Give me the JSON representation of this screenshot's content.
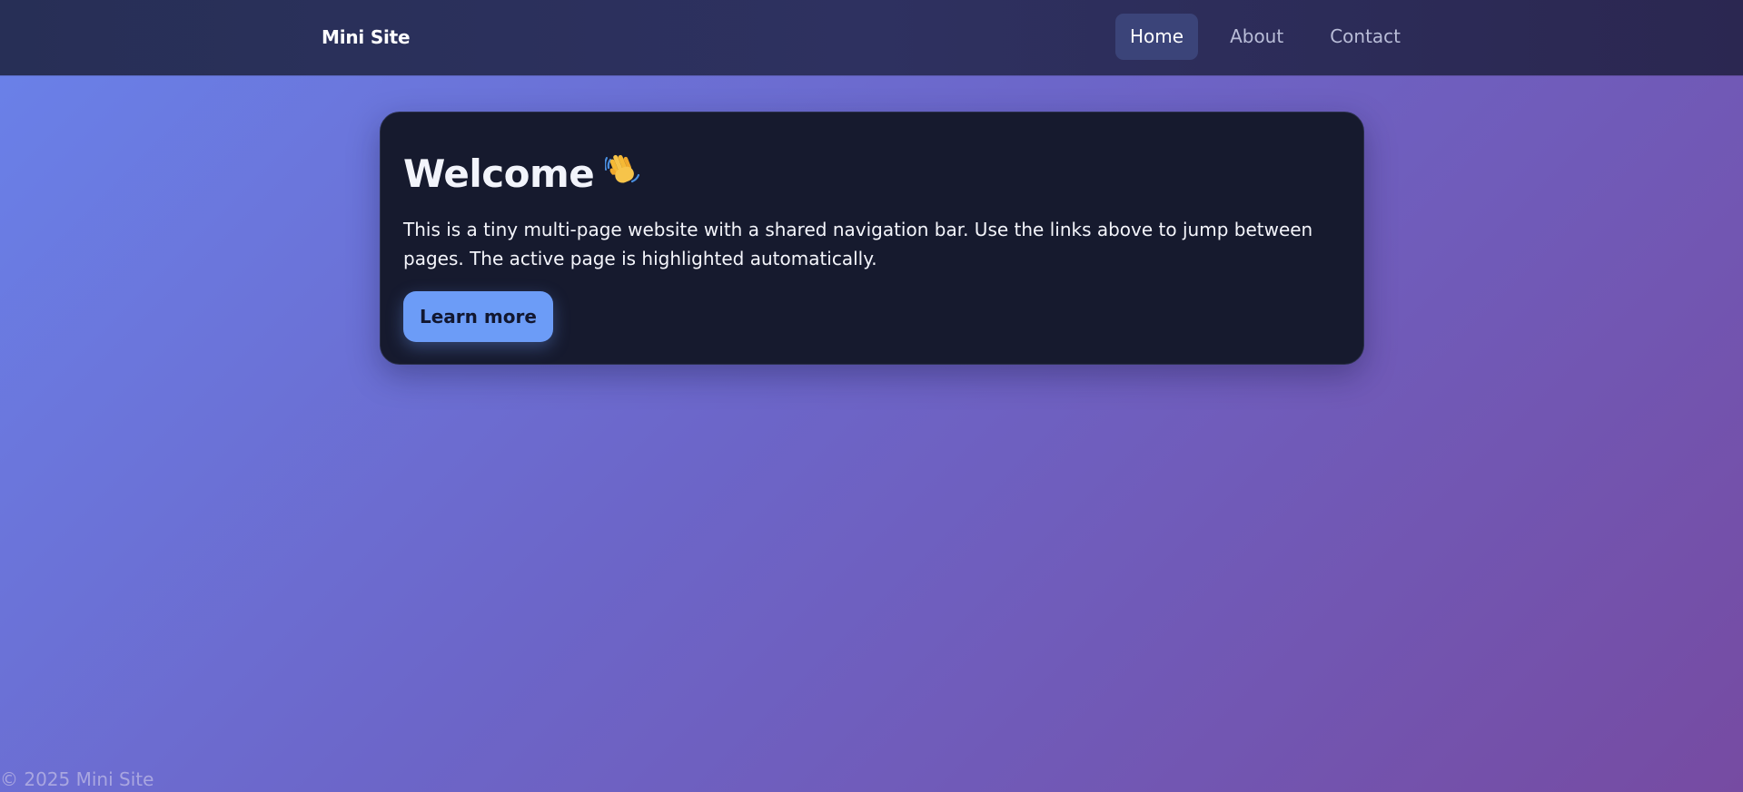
{
  "navbar": {
    "brand": "Mini Site",
    "links": [
      {
        "label": "Home",
        "active": true
      },
      {
        "label": "About",
        "active": false
      },
      {
        "label": "Contact",
        "active": false
      }
    ]
  },
  "main": {
    "title": "Welcome",
    "title_icon": "waving-hand-icon",
    "description": "This is a tiny multi-page website with a shared navigation bar. Use the links above to jump between pages. The active page is highlighted automatically.",
    "button_label": "Learn more"
  },
  "footer": {
    "text": "© 2025 Mini Site"
  },
  "colors": {
    "nav_active_bg": "#3b4479",
    "card_bg": "#161a2e",
    "button_bg": "#6c9cf7",
    "gradient_start": "#6a82ea",
    "gradient_end": "#764ba2"
  }
}
